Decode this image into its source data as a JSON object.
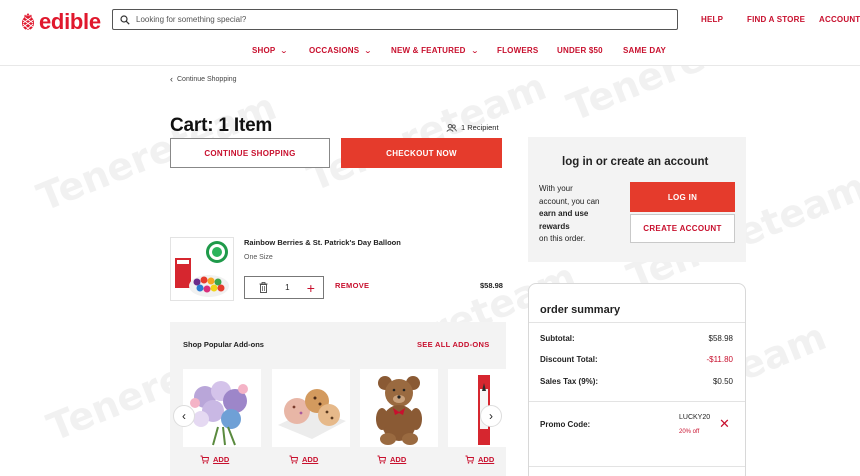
{
  "header": {
    "logo_text": "edible",
    "search_placeholder": "Looking for something special?",
    "top_links": {
      "help": "HELP",
      "find_store": "FIND A STORE",
      "account": "ACCOUNT"
    },
    "nav": {
      "shop": "SHOP",
      "occasions": "OCCASIONS",
      "new_featured": "NEW & FEATURED",
      "flowers": "FLOWERS",
      "under50": "UNDER $50",
      "same_day": "SAME DAY"
    }
  },
  "breadcrumb": {
    "chevron": "‹",
    "label": "Continue Shopping"
  },
  "cart": {
    "title": "Cart: 1 Item",
    "recipient": "1 Recipient",
    "continue_label": "CONTINUE SHOPPING",
    "checkout_label": "CHECKOUT NOW"
  },
  "item": {
    "name": "Rainbow Berries & St. Patrick's Day Balloon",
    "size": "One Size",
    "quantity": "1",
    "remove_label": "REMOVE",
    "price": "$58.98"
  },
  "addons": {
    "title": "Shop Popular Add-ons",
    "see_all": "SEE ALL ADD-ONS",
    "add_label": "ADD",
    "prev": "‹",
    "next": "›"
  },
  "login": {
    "title": "log in or create an account",
    "text_line1": "With your",
    "text_line2": "account, you can",
    "text_bold1": "earn and use",
    "text_bold2": "rewards",
    "text_line5": "on this order.",
    "login_label": "LOG IN",
    "create_label": "CREATE ACCOUNT"
  },
  "summary": {
    "title": "order summary",
    "subtotal_label": "Subtotal:",
    "subtotal_value": "$58.98",
    "discount_label": "Discount Total:",
    "discount_value": "-$11.80",
    "tax_label": "Sales Tax (9%):",
    "tax_value": "$0.50",
    "promo_label": "Promo Code:",
    "promo_code": "LUCKY20",
    "promo_off": "20% off",
    "promo_remove": "✕"
  },
  "watermark": "Tenereteam",
  "colors": {
    "brand_red": "#e0182d",
    "button_red": "#e53b2c",
    "panel_gray": "#f3f3f3"
  }
}
